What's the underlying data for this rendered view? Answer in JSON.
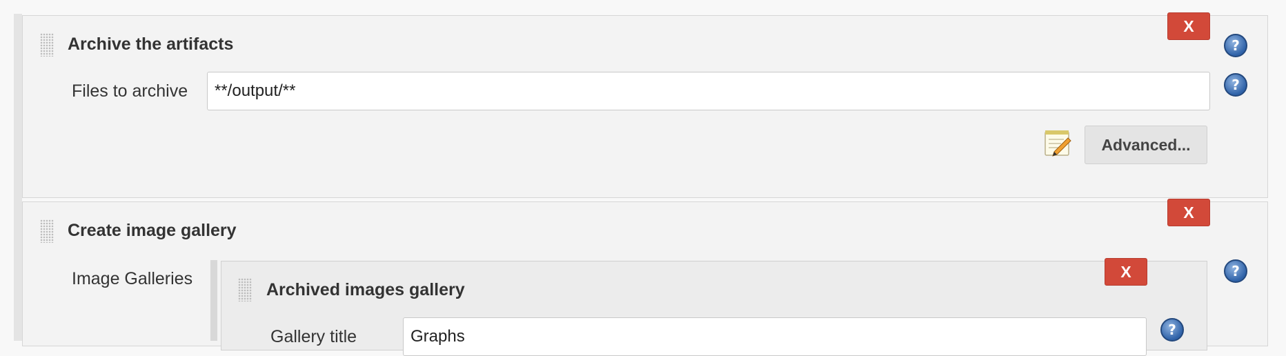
{
  "archive": {
    "title": "Archive the artifacts",
    "delete_label": "X",
    "files_label": "Files to archive",
    "files_value": "**/output/**",
    "advanced_label": "Advanced..."
  },
  "gallery": {
    "title": "Create image gallery",
    "delete_label": "X",
    "galleries_label": "Image Galleries",
    "inner": {
      "title": "Archived images gallery",
      "delete_label": "X",
      "gallery_title_label": "Gallery title",
      "gallery_title_value": "Graphs"
    }
  },
  "help_glyph": "?",
  "icons": {
    "drag": "drag-handle-icon",
    "help": "help-icon",
    "notepad": "notepad-pencil-icon"
  },
  "colors": {
    "delete_button": "#d24939",
    "help_icon": "#2f62a8"
  }
}
